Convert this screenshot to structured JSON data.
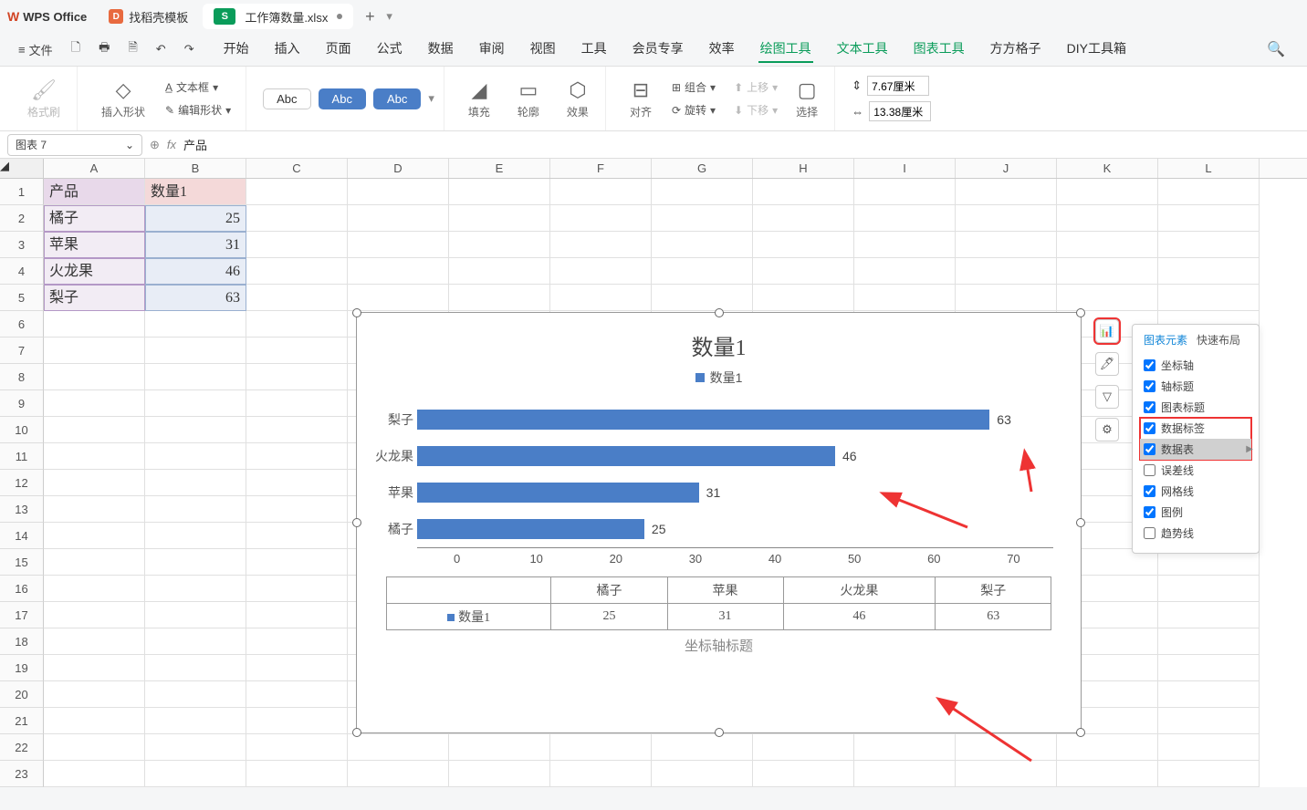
{
  "app_name": "WPS Office",
  "tabs": [
    {
      "label": "找稻壳模板",
      "icon": "D"
    },
    {
      "label": "工作簿数量.xlsx",
      "icon": "S",
      "active": true
    }
  ],
  "menu": {
    "file": "文件",
    "items": [
      "开始",
      "插入",
      "页面",
      "公式",
      "数据",
      "审阅",
      "视图",
      "工具",
      "会员专享",
      "效率",
      "绘图工具",
      "文本工具",
      "图表工具",
      "方方格子",
      "DIY工具箱"
    ],
    "active": "绘图工具"
  },
  "ribbon": {
    "format_brush": "格式刷",
    "insert_shape": "插入形状",
    "text_box": "文本框",
    "edit_shape": "编辑形状",
    "abc": "Abc",
    "fill": "填充",
    "outline": "轮廓",
    "effect": "效果",
    "align": "对齐",
    "combine": "组合",
    "rotate": "旋转",
    "move_up": "上移",
    "move_down": "下移",
    "select": "选择",
    "width": "7.67厘米",
    "height": "13.38厘米"
  },
  "formula": {
    "name_box": "图表 7",
    "content": "产品"
  },
  "columns": [
    "A",
    "B",
    "C",
    "D",
    "E",
    "F",
    "G",
    "H",
    "I",
    "J",
    "K",
    "L"
  ],
  "sheet": {
    "headers": [
      "产品",
      "数量1"
    ],
    "rows": [
      {
        "a": "橘子",
        "b": 25
      },
      {
        "a": "苹果",
        "b": 31
      },
      {
        "a": "火龙果",
        "b": 46
      },
      {
        "a": "梨子",
        "b": 63
      }
    ]
  },
  "chart_data": {
    "type": "bar",
    "title": "数量1",
    "legend": "数量1",
    "categories": [
      "梨子",
      "火龙果",
      "苹果",
      "橘子"
    ],
    "values": [
      63,
      46,
      31,
      25
    ],
    "xticks": [
      0,
      10,
      20,
      30,
      40,
      50,
      60,
      70
    ],
    "xmax": 70,
    "axis_title": "坐标轴标题",
    "table_series": "数量1",
    "table_categories": [
      "橘子",
      "苹果",
      "火龙果",
      "梨子"
    ],
    "table_values": [
      25,
      31,
      46,
      63
    ]
  },
  "panel": {
    "tab1": "图表元素",
    "tab2": "快速布局",
    "items": [
      {
        "label": "坐标轴",
        "checked": true
      },
      {
        "label": "轴标题",
        "checked": true
      },
      {
        "label": "图表标题",
        "checked": true
      },
      {
        "label": "数据标签",
        "checked": true,
        "hl": true
      },
      {
        "label": "数据表",
        "checked": true,
        "hl": true,
        "sel": true,
        "arrow": true
      },
      {
        "label": "误差线",
        "checked": false
      },
      {
        "label": "网格线",
        "checked": true
      },
      {
        "label": "图例",
        "checked": true
      },
      {
        "label": "趋势线",
        "checked": false
      }
    ]
  }
}
